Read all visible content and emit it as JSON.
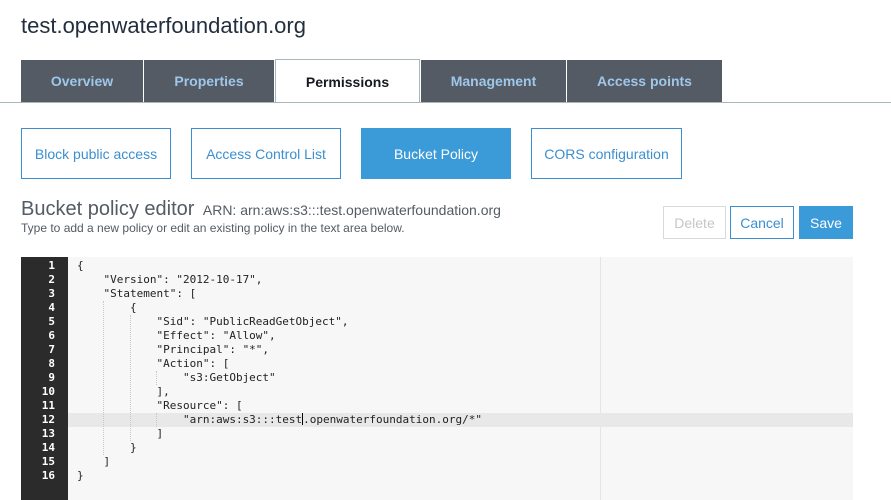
{
  "bucket": {
    "title": "test.openwaterfoundation.org"
  },
  "tabs": [
    {
      "label": "Overview",
      "active": false
    },
    {
      "label": "Properties",
      "active": false
    },
    {
      "label": "Permissions",
      "active": true
    },
    {
      "label": "Management",
      "active": false
    },
    {
      "label": "Access points",
      "active": false
    }
  ],
  "subtabs": [
    {
      "label": "Block public access",
      "active": false
    },
    {
      "label": "Access Control List",
      "active": false
    },
    {
      "label": "Bucket Policy",
      "active": true
    },
    {
      "label": "CORS configuration",
      "active": false
    }
  ],
  "editor": {
    "title": "Bucket policy editor",
    "arn": "ARN: arn:aws:s3:::test.openwaterfoundation.org",
    "description": "Type to add a new policy or edit an existing policy in the text area below.",
    "delete_label": "Delete",
    "cancel_label": "Cancel",
    "save_label": "Save",
    "cursor_line": 12,
    "lines": [
      {
        "n": "1",
        "text": "{"
      },
      {
        "n": "2",
        "text": "    \"Version\": \"2012-10-17\","
      },
      {
        "n": "3",
        "text": "    \"Statement\": ["
      },
      {
        "n": "4",
        "text": "        {"
      },
      {
        "n": "5",
        "text": "            \"Sid\": \"PublicReadGetObject\","
      },
      {
        "n": "6",
        "text": "            \"Effect\": \"Allow\","
      },
      {
        "n": "7",
        "text": "            \"Principal\": \"*\","
      },
      {
        "n": "8",
        "text": "            \"Action\": ["
      },
      {
        "n": "9",
        "text": "                \"s3:GetObject\""
      },
      {
        "n": "10",
        "text": "            ],"
      },
      {
        "n": "11",
        "text": "            \"Resource\": ["
      },
      {
        "n": "12",
        "text": "                \"arn:aws:s3:::test.openwaterfoundation.org/*\""
      },
      {
        "n": "13",
        "text": "            ]"
      },
      {
        "n": "14",
        "text": "        }"
      },
      {
        "n": "15",
        "text": "    ]"
      },
      {
        "n": "16",
        "text": "}"
      }
    ]
  },
  "colors": {
    "tab_bg": "#545b64",
    "tab_text": "#9ec7ea",
    "accent": "#3b9ad8",
    "gutter_bg": "#2b2b2b"
  }
}
